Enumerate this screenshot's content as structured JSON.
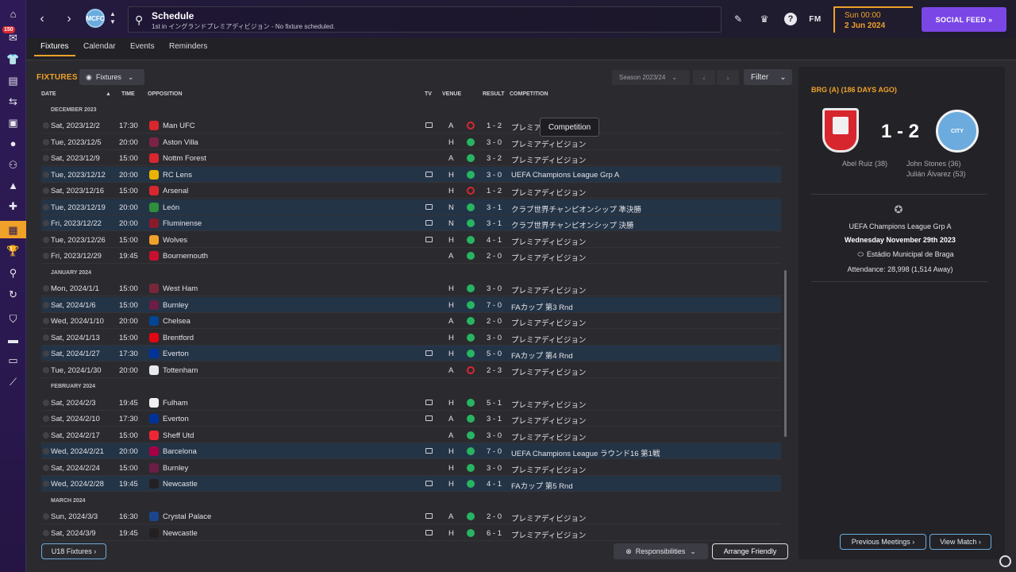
{
  "sidebar": {
    "badge": "150",
    "icons": [
      "home-icon",
      "inbox-icon",
      "kit-icon",
      "clipboard-icon",
      "transfer-icon",
      "report-icon",
      "ball-icon",
      "people-icon",
      "training-icon",
      "medical-icon",
      "calendar-icon",
      "trophy-icon",
      "search-icon",
      "refresh-icon",
      "shield-icon",
      "briefcase-icon",
      "ticket-icon",
      "trend-icon"
    ]
  },
  "topbar": {
    "back": "‹",
    "forward": "›",
    "club_badge": "MCFC",
    "title": "Schedule",
    "subtitle": "1st in イングランドプレミアディビジョン - No fixture scheduled.",
    "time": "Sun 00:00",
    "date": "2 Jun 2024",
    "fm": "FM",
    "social_feed": "SOCIAL FEED  »"
  },
  "tabs": [
    "Fixtures",
    "Calendar",
    "Events",
    "Reminders"
  ],
  "fixtures": {
    "title": "FIXTURES",
    "dropdown": "Fixtures",
    "season": "Season 2023/24",
    "filter": "Filter",
    "columns": {
      "date": "DATE",
      "time": "TIME",
      "opposition": "OPPOSITION",
      "tv": "TV",
      "venue": "VENUE",
      "result": "RESULT",
      "competition": "COMPETITION"
    },
    "months": {
      "dec": "DECEMBER 2023",
      "jan": "JANUARY 2024",
      "feb": "FEBRUARY 2024",
      "mar": "MARCH 2024"
    },
    "rows": [
      {
        "date": "Sat, 2023/12/2",
        "time": "17:30",
        "opp": "Man UFC",
        "venue": "A",
        "result": "1 - 2",
        "comp": "プレミア"
      },
      {
        "date": "Tue, 2023/12/5",
        "time": "20:00",
        "opp": "Aston Villa",
        "venue": "H",
        "result": "3 - 0",
        "comp": "プレミアディビジョン"
      },
      {
        "date": "Sat, 2023/12/9",
        "time": "15:00",
        "opp": "Nottm Forest",
        "venue": "A",
        "result": "3 - 2",
        "comp": "プレミアディビジョン"
      },
      {
        "date": "Tue, 2023/12/12",
        "time": "20:00",
        "opp": "RC Lens",
        "venue": "H",
        "result": "3 - 0",
        "comp": "UEFA Champions League Grp A"
      },
      {
        "date": "Sat, 2023/12/16",
        "time": "15:00",
        "opp": "Arsenal",
        "venue": "H",
        "result": "1 - 2",
        "comp": "プレミアディビジョン"
      },
      {
        "date": "Tue, 2023/12/19",
        "time": "20:00",
        "opp": "León",
        "venue": "N",
        "result": "3 - 1",
        "comp": "クラブ世界チャンピオンシップ 準決勝"
      },
      {
        "date": "Fri, 2023/12/22",
        "time": "20:00",
        "opp": "Fluminense",
        "venue": "N",
        "result": "3 - 1",
        "comp": "クラブ世界チャンピオンシップ 決勝"
      },
      {
        "date": "Tue, 2023/12/26",
        "time": "15:00",
        "opp": "Wolves",
        "venue": "H",
        "result": "4 - 1",
        "comp": "プレミアディビジョン"
      },
      {
        "date": "Fri, 2023/12/29",
        "time": "19:45",
        "opp": "Bournemouth",
        "venue": "A",
        "result": "2 - 0",
        "comp": "プレミアディビジョン"
      },
      {
        "date": "Mon, 2024/1/1",
        "time": "15:00",
        "opp": "West Ham",
        "venue": "H",
        "result": "3 - 0",
        "comp": "プレミアディビジョン"
      },
      {
        "date": "Sat, 2024/1/6",
        "time": "15:00",
        "opp": "Burnley",
        "venue": "H",
        "result": "7 - 0",
        "comp": "FAカップ 第3 Rnd"
      },
      {
        "date": "Wed, 2024/1/10",
        "time": "20:00",
        "opp": "Chelsea",
        "venue": "A",
        "result": "2 - 0",
        "comp": "プレミアディビジョン"
      },
      {
        "date": "Sat, 2024/1/13",
        "time": "15:00",
        "opp": "Brentford",
        "venue": "H",
        "result": "3 - 0",
        "comp": "プレミアディビジョン"
      },
      {
        "date": "Sat, 2024/1/27",
        "time": "17:30",
        "opp": "Everton",
        "venue": "H",
        "result": "5 - 0",
        "comp": "FAカップ 第4 Rnd"
      },
      {
        "date": "Tue, 2024/1/30",
        "time": "20:00",
        "opp": "Tottenham",
        "venue": "A",
        "result": "2 - 3",
        "comp": "プレミアディビジョン"
      },
      {
        "date": "Sat, 2024/2/3",
        "time": "19:45",
        "opp": "Fulham",
        "venue": "H",
        "result": "5 - 1",
        "comp": "プレミアディビジョン"
      },
      {
        "date": "Sat, 2024/2/10",
        "time": "17:30",
        "opp": "Everton",
        "venue": "A",
        "result": "3 - 1",
        "comp": "プレミアディビジョン"
      },
      {
        "date": "Sat, 2024/2/17",
        "time": "15:00",
        "opp": "Sheff Utd",
        "venue": "A",
        "result": "3 - 0",
        "comp": "プレミアディビジョン"
      },
      {
        "date": "Wed, 2024/2/21",
        "time": "20:00",
        "opp": "Barcelona",
        "venue": "H",
        "result": "7 - 0",
        "comp": "UEFA Champions League ラウンド16 第1戦"
      },
      {
        "date": "Sat, 2024/2/24",
        "time": "15:00",
        "opp": "Burnley",
        "venue": "H",
        "result": "3 - 0",
        "comp": "プレミアディビジョン"
      },
      {
        "date": "Wed, 2024/2/28",
        "time": "19:45",
        "opp": "Newcastle",
        "venue": "H",
        "result": "4 - 1",
        "comp": "FAカップ 第5 Rnd"
      },
      {
        "date": "Sun, 2024/3/3",
        "time": "16:30",
        "opp": "Crystal Palace",
        "venue": "A",
        "result": "2 - 0",
        "comp": "プレミアディビジョン"
      },
      {
        "date": "Sat, 2024/3/9",
        "time": "19:45",
        "opp": "Newcastle",
        "venue": "H",
        "result": "6 - 1",
        "comp": "プレミアディビジョン"
      }
    ],
    "tooltip": "Competition",
    "u18_button": "U18 Fixtures ›",
    "responsibilities": "Responsibilities",
    "arrange_friendly": "Arrange Friendly"
  },
  "match_panel": {
    "header": "BRG (A) (186 DAYS AGO)",
    "score": "1 - 2",
    "away_crest": "CITY",
    "home_scorer": "Abel Ruiz (38)",
    "away_scorers": [
      "John Stones (36)",
      "Julián Álvarez (53)"
    ],
    "competition": "UEFA Champions League Grp A",
    "date": "Wednesday November 29th 2023",
    "stadium": "Estádio Municipal de Braga",
    "attendance": "Attendance: 28,998 (1,514 Away)",
    "previous_meetings": "Previous Meetings ›",
    "view_match": "View Match ›"
  },
  "colors": {
    "accent": "#f0a12a",
    "win": "#27b561",
    "loss": "#d8262f",
    "social": "#7a47e6",
    "highlight_row": "#243447"
  }
}
